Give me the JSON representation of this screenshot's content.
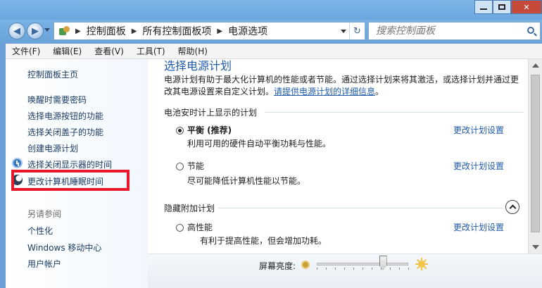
{
  "window": {
    "caption_buttons": {
      "minimize": "minimize",
      "maximize": "maximize",
      "close": "✕"
    }
  },
  "address_bar": {
    "breadcrumbs": [
      "控制面板",
      "所有控制面板项",
      "电源选项"
    ],
    "search_placeholder": "搜索控制面板"
  },
  "menu": [
    "文件(F)",
    "编辑(E)",
    "查看(V)",
    "工具(T)",
    "帮助(H)"
  ],
  "sidebar": {
    "home": "控制面板主页",
    "links": [
      "唤醒时需要密码",
      "选择电源按钮的功能",
      "选择关闭盖子的功能",
      "创建电源计划",
      "选择关闭显示器的时间",
      "更改计算机睡眠时间"
    ],
    "see_also_title": "另请参阅",
    "see_also": [
      "个性化",
      "Windows 移动中心",
      "用户帐户"
    ]
  },
  "main": {
    "title": "选择电源计划",
    "intro": "电源计划有助于最大化计算机的性能或者节能。通过选择计划来将其激活，或选择计划并通过更改其电源设置来自定义计划。",
    "intro_link": "请提供电源计划的详细信息",
    "intro_end": "。",
    "battery_group": "电池安时计上显示的计划",
    "plans": [
      {
        "name": "平衡 (推荐)",
        "desc": "利用可用的硬件自动平衡功耗与性能。",
        "selected": true,
        "link": "更改计划设置"
      },
      {
        "name": "节能",
        "desc": "尽可能降低计算机性能以节能。",
        "selected": false,
        "link": "更改计划设置"
      }
    ],
    "hidden_group": "隐藏附加计划",
    "hidden_plans": [
      {
        "name": "高性能",
        "desc": "有利于提高性能，但会增加功耗。",
        "selected": false,
        "link": "更改计划设置"
      }
    ]
  },
  "brightness": {
    "label": "屏幕亮度:",
    "level_percent": 72
  },
  "icons": {
    "back": "arrow-left-icon",
    "forward": "arrow-right-icon",
    "refresh": "refresh-icon",
    "search": "search-icon"
  }
}
